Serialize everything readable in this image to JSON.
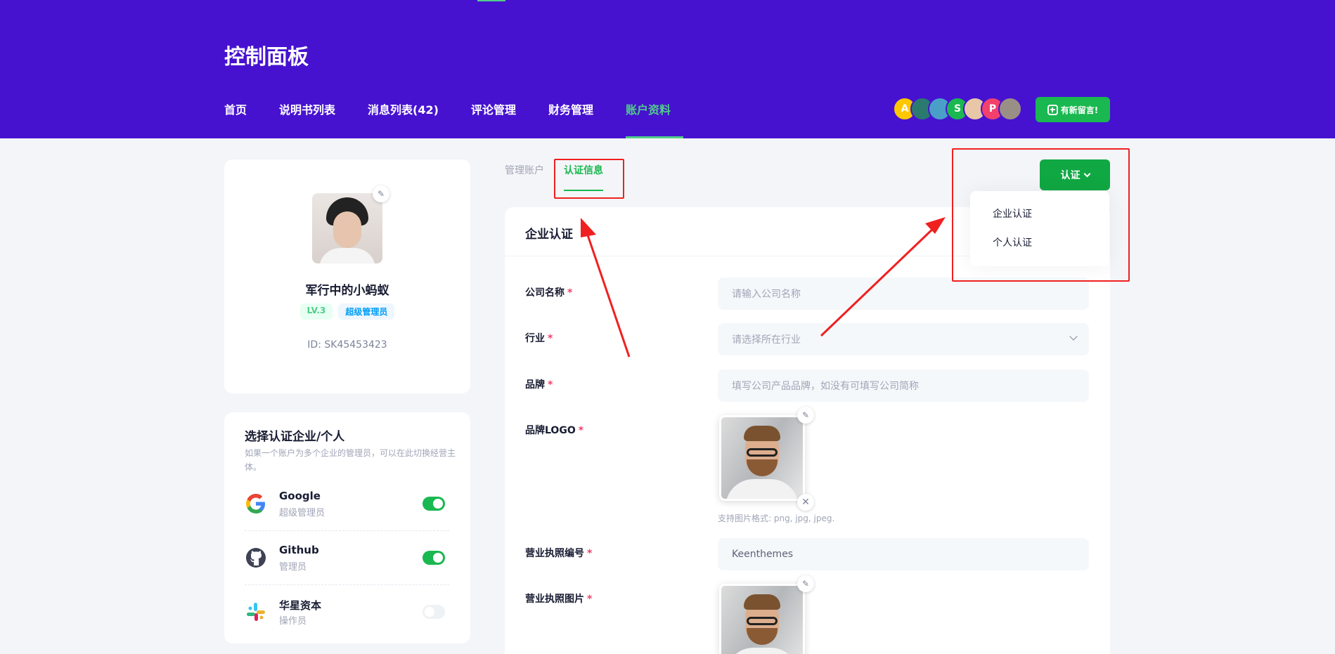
{
  "header": {
    "title": "控制面板",
    "nav": [
      {
        "label": "首页"
      },
      {
        "label": "说明书列表"
      },
      {
        "label": "消息列表(42)"
      },
      {
        "label": "评论管理"
      },
      {
        "label": "财务管理"
      },
      {
        "label": "账户资料",
        "active": true
      }
    ],
    "avatars": [
      {
        "letter": "A",
        "color": "#ffc700"
      },
      {
        "letter": "",
        "color": "#2b7a6f"
      },
      {
        "letter": "",
        "color": "#4a9fc9"
      },
      {
        "letter": "S",
        "color": "#1ab850"
      },
      {
        "letter": "",
        "color": "#e8c7a8"
      },
      {
        "letter": "P",
        "color": "#f1416c"
      },
      {
        "letter": "",
        "color": "#9a8f86"
      }
    ],
    "message_button": "有新留言!"
  },
  "profile": {
    "name": "军行中的小蚂蚁",
    "level": "LV.3",
    "role": "超级管理员",
    "id_label": "ID: SK45453423"
  },
  "switcher": {
    "title": "选择认证企业/个人",
    "description": "如果一个账户为多个企业的管理员，可以在此切换经营主体。",
    "accounts": [
      {
        "name": "Google",
        "role": "超级管理员",
        "enabled": true
      },
      {
        "name": "Github",
        "role": "管理员",
        "enabled": true
      },
      {
        "name": "华星资本",
        "role": "操作员",
        "enabled": false
      }
    ]
  },
  "tabs": [
    {
      "label": "管理账户"
    },
    {
      "label": "认证信息",
      "active": true
    }
  ],
  "verify_button": "认证",
  "dropdown": [
    "企业认证",
    "个人认证"
  ],
  "form": {
    "title": "企业认证",
    "company_label": "公司名称",
    "company_placeholder": "请输入公司名称",
    "industry_label": "行业",
    "industry_placeholder": "请选择所在行业",
    "brand_label": "品牌",
    "brand_placeholder": "填写公司产品品牌，如没有可填写公司简称",
    "logo_label": "品牌LOGO",
    "logo_hint": "支持图片格式: png, jpg, jpeg.",
    "license_no_label": "营业执照编号",
    "license_no_value": "Keenthemes",
    "license_img_label": "营业执照图片"
  },
  "colors": {
    "header_bg": "#4612d0",
    "accent_green": "#1ab850",
    "active_tab": "#50cd89",
    "annotation_red": "#f02020"
  }
}
